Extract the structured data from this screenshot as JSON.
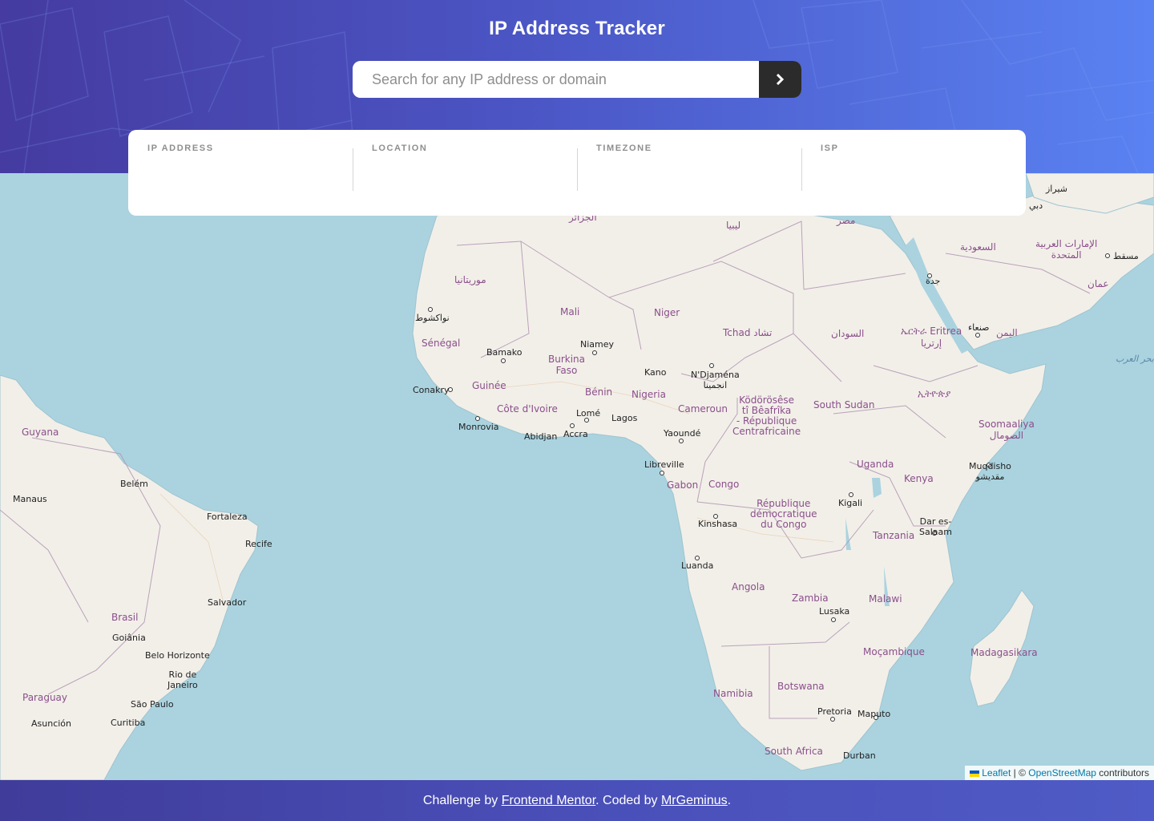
{
  "header": {
    "title": "IP Address Tracker",
    "search_placeholder": "Search for any IP address or domain",
    "search_value": "",
    "submit_icon": "chevron-right-icon"
  },
  "info": {
    "ip_label": "IP ADDRESS",
    "ip_value": "",
    "location_label": "LOCATION",
    "location_value": "",
    "timezone_label": "TIMEZONE",
    "timezone_value": "",
    "isp_label": "ISP",
    "isp_value": ""
  },
  "map": {
    "labels": {
      "guyana": "Guyana",
      "belem": "Belém",
      "manaus": "Manaus",
      "fortaleza": "Fortaleza",
      "recife": "Recife",
      "salvador": "Salvador",
      "brasil": "Brasil",
      "goiania": "Goiânia",
      "belo": "Belo Horizonte",
      "rio": "Rio de\nJaneiro",
      "saopaulo": "São Paulo",
      "curitiba": "Curitiba",
      "paraguay": "Paraguay",
      "asuncion": "Asunción",
      "mauritania": "موريتانيا",
      "nouakchott": "نواكشوط",
      "senegal": "Sénégal",
      "bamako": "Bamako",
      "mali": "Mali",
      "niamey": "Niamey",
      "niger": "Niger",
      "burkina": "Burkina\nFaso",
      "conakry": "Conakry",
      "guinee": "Guinée",
      "cote": "Côte d'Ivoire",
      "monrovia": "Monrovia",
      "abidjan": "Abidjan",
      "accra": "Accra",
      "lome": "Lomé",
      "benin": "Bénin",
      "lagos": "Lagos",
      "kano": "Kano",
      "nigeria": "Nigeria",
      "ndjamena": "N'Djaména\nانجمينا",
      "tchad": "Tchad تشاد",
      "cameroun": "Cameroun",
      "yaounde": "Yaoundé",
      "car": "Ködörösêse\ntî Bêafrîka\n- République\nCentrafricaine",
      "libreville": "Libreville",
      "gabon": "Gabon",
      "congo": "Congo",
      "kinshasa": "Kinshasa",
      "rdc": "République\ndémocratique\ndu Congo",
      "luanda": "Luanda",
      "angola": "Angola",
      "zambia": "Zambia",
      "lusaka": "Lusaka",
      "namibia": "Namibia",
      "botswana": "Botswana",
      "pretoria": "Pretoria",
      "maputo": "Maputo",
      "southafrica": "South Africa",
      "durban": "Durban",
      "mocambique": "Moçambique",
      "malawi": "Malawi",
      "tanzania": "Tanzania",
      "daressalaam": "Dar es-\nSalaam",
      "kigali": "Kigali",
      "uganda": "Uganda",
      "kenya": "Kenya",
      "mogadishu": "Muqdisho\nمقديشو",
      "somalia": "Soomaaliya\nالصومال",
      "southsudan": "South Sudan",
      "sudan": "السودان",
      "ethiopia": "ኢትዮጵያ",
      "eritrea": "ኤርትራ Eritrea\nإرتريا",
      "sanaa": "صنعاء",
      "yemen": "اليمن",
      "jeddah": "جدة",
      "saudi": "السعودية",
      "uae": "الإمارات العربية\nالمتحدة",
      "oman": "عمان",
      "muscat": "مسقط",
      "shiraz": "شيراز",
      "egypt": "مصر",
      "libya": "ليبيا",
      "algeria": "الجزائر",
      "madagasikara": "Madagasikara",
      "arabiansea": "بحر العرب",
      "dubai": "دبي"
    },
    "attribution": {
      "leaflet": "Leaflet",
      "separator": " | © ",
      "osm": "OpenStreetMap",
      "contributors": " contributors"
    }
  },
  "footer": {
    "prefix": "Challenge by ",
    "frontend_mentor": "Frontend Mentor",
    "middle": ". Coded by ",
    "author": "MrGeminus",
    "suffix": "."
  },
  "colors": {
    "header_start": "#453ba0",
    "header_end": "#5a82f2",
    "button": "#2b2b2b",
    "sea": "#aad3df",
    "land": "#f2efe9",
    "border": "#b39ab5"
  }
}
